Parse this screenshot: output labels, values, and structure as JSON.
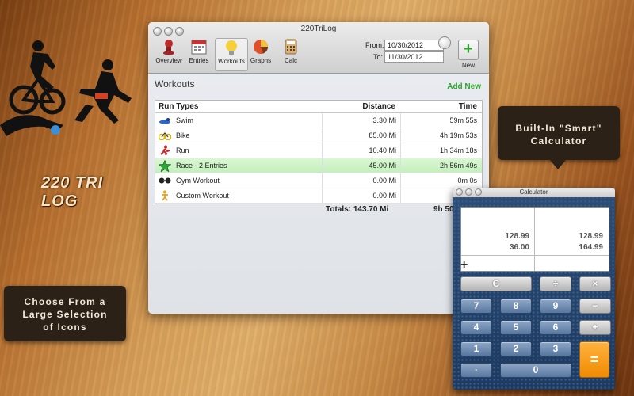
{
  "brand": {
    "logo_text": "220 TRI LOG"
  },
  "callouts": {
    "calculator": [
      "Built-In \"Smart\"",
      "Calculator"
    ],
    "icons": [
      "Choose From a",
      "Large Selection",
      "of Icons"
    ]
  },
  "window": {
    "title": "220TriLog",
    "toolbar": [
      {
        "label": "Overview",
        "icon": "pushpin-icon"
      },
      {
        "label": "Entries",
        "icon": "calendar-icon"
      },
      {
        "label": "Workouts",
        "icon": "lightbulb-icon"
      },
      {
        "label": "Graphs",
        "icon": "pie-chart-icon"
      },
      {
        "label": "Calc",
        "icon": "calculator-icon"
      }
    ],
    "from_label": "From:",
    "from_value": "10/30/2012",
    "to_label": "To:",
    "to_value": "11/30/2012",
    "new_label": "New",
    "section_title": "Workouts",
    "add_new": "Add New",
    "columns": [
      "Run Types",
      "Distance",
      "Time"
    ],
    "rows": [
      {
        "name": "Swim",
        "distance": "3.30 Mi",
        "time": "59m 55s",
        "icon": "swimmer-icon"
      },
      {
        "name": "Bike",
        "distance": "85.00 Mi",
        "time": "4h 19m 53s",
        "icon": "bicycle-icon"
      },
      {
        "name": "Run",
        "distance": "10.40 Mi",
        "time": "1h 34m 18s",
        "icon": "runner-icon"
      },
      {
        "name": "Race - 2 Entries",
        "distance": "45.00 Mi",
        "time": "2h 56m 49s",
        "icon": "star-icon"
      },
      {
        "name": "Gym Workout",
        "distance": "0.00 Mi",
        "time": "0m 0s",
        "icon": "dumbbell-icon"
      },
      {
        "name": "Custom Workout",
        "distance": "0.00 Mi",
        "time": "0m 0s",
        "icon": "figure-icon"
      }
    ],
    "totals_distance": "Totals: 143.70 Mi",
    "totals_time": "9h 50"
  },
  "calculator": {
    "title": "Calculator",
    "left_col": [
      "128.99",
      "36.00"
    ],
    "right_col": [
      "128.99",
      "164.99"
    ],
    "operator": "+",
    "keys": {
      "clear": "C",
      "divide": "÷",
      "multiply": "×",
      "minus": "−",
      "plus": "+",
      "equals": "=",
      "n7": "7",
      "n8": "8",
      "n9": "9",
      "n4": "4",
      "n5": "5",
      "n6": "6",
      "n1": "1",
      "n2": "2",
      "n3": "3",
      "n0": "0",
      "dot": "·"
    }
  }
}
